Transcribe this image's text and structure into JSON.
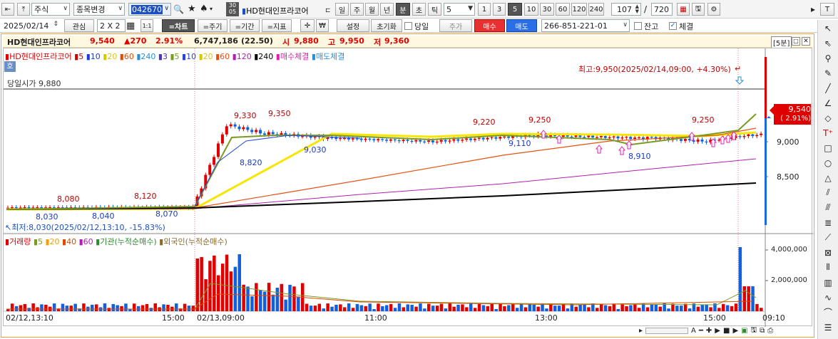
{
  "toolbar": {
    "market": "주식",
    "search_btn": "종목변경",
    "code": "042670",
    "stock_name": "HD현대인프라코어",
    "period_lbl_top": "30",
    "period_lbl_bot": "05",
    "periods": [
      "일",
      "주",
      "월",
      "년",
      "분",
      "초",
      "틱"
    ],
    "tick_value": "5",
    "quick": [
      "1",
      "3",
      "5",
      "10",
      "30",
      "60",
      "120",
      "240"
    ],
    "count": "107",
    "total": "720",
    "total_sep": "/"
  },
  "toolbar2": {
    "date": "2025/02/14",
    "interest": "관심",
    "layout": "2 X 2",
    "one": "1:1",
    "chart_btn": "=차트",
    "jugi": "=주기",
    "gigan": "=기간",
    "jipyo": "=지표",
    "settings": "설정",
    "reset": "초기화",
    "same_day": "당일",
    "jusiga": "주가",
    "buy": "매수",
    "sell": "매도",
    "account": "266-851-221-01",
    "balance": "잔고",
    "fill": "체결"
  },
  "info": {
    "name": "HD현대인프라코어",
    "price": "9,540",
    "change": "▲270",
    "pct": "2.91%",
    "volume": "6,747,186",
    "ratio": "(22.50)",
    "open_lbl": "시",
    "open": "9,880",
    "high_lbl": "고",
    "high": "9,950",
    "low_lbl": "저",
    "low": "9,360",
    "interval": "[5분]"
  },
  "legend": {
    "series": "HD현대인프라코어",
    "ma": [
      {
        "label": "5",
        "color": "#d00000"
      },
      {
        "label": "10",
        "color": "#1f3ad8"
      },
      {
        "label": "20",
        "color": "#f2e300"
      },
      {
        "label": "60",
        "color": "#e24a00"
      },
      {
        "label": "240",
        "color": "#2a8fd0"
      },
      {
        "label": "3",
        "color": "#4a34c0"
      },
      {
        "label": "5",
        "color": "#7a9a20"
      },
      {
        "label": "10",
        "color": "#2545d8"
      },
      {
        "label": "20",
        "color": "#f7e600"
      },
      {
        "label": "60",
        "color": "#e85010"
      },
      {
        "label": "120",
        "color": "#b020b0"
      },
      {
        "label": "240",
        "color": "#000000"
      }
    ],
    "buy_fill": "매수체결",
    "sell_fill": "매도체결",
    "ho": "호"
  },
  "annotations": {
    "open_price": "당일시가 9,880",
    "high": "최고:9,950(2025/02/14,09:00, +4.30%)",
    "low": "최저:8,030(2025/02/12,13:10, -15.83%)"
  },
  "price_labels": {
    "up": [
      "8,080",
      "8,120",
      "9,330",
      "9,350",
      "9,220",
      "9,250",
      "9,250"
    ],
    "down": [
      "8,030",
      "8,040",
      "8,070",
      "8,820",
      "9,030",
      "9,110",
      "8,910"
    ]
  },
  "yaxis": {
    "price_ticks": [
      "9,000",
      "8,500"
    ],
    "current_price": "9,540",
    "current_pct": "( 2.91%)",
    "volume_ticks": [
      "4,000,000",
      "2,000,000"
    ]
  },
  "volume_legend": {
    "title": "거래량",
    "ma": [
      {
        "label": "5",
        "color": "#7a9a20"
      },
      {
        "label": "20",
        "color": "#f2a200"
      },
      {
        "label": "40",
        "color": "#e24a00"
      },
      {
        "label": "60",
        "color": "#b020b0"
      }
    ],
    "inst": "기관(누적순매수)",
    "foreign": "외국인(누적순매수)"
  },
  "xaxis": {
    "labels": [
      "02/12,13:10",
      "15:00",
      "02/13,09:00",
      "11:00",
      "13:00",
      "15:00",
      "09:10"
    ]
  },
  "colors": {
    "up": "#e00000",
    "down": "#1060e0",
    "accent": "#f08020"
  }
}
